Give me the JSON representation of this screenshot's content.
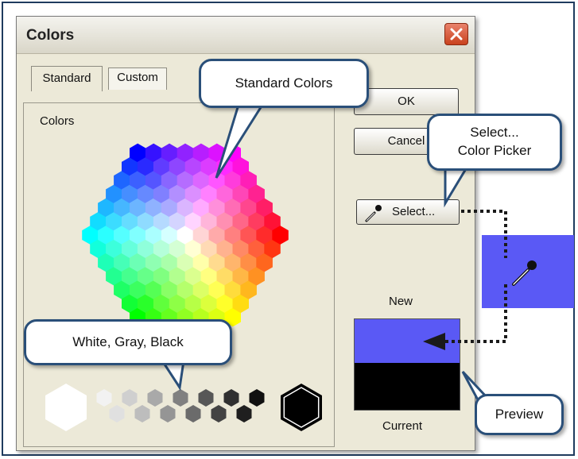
{
  "dialog": {
    "title": "Colors",
    "tabs": [
      {
        "label": "Standard"
      },
      {
        "label": "Custom"
      }
    ],
    "colors_label": "Colors",
    "ok_label": "OK",
    "cancel_label": "Cancel",
    "select_label": "Select...",
    "new_label": "New",
    "current_label": "Current"
  },
  "callouts": {
    "standard_colors": "Standard Colors",
    "select_line1": "Select...",
    "select_line2": "Color Picker",
    "gray_scale": "White, Gray, Black",
    "preview": "Preview"
  },
  "preview_colors": {
    "new": "#5a59f5",
    "current": "#000000"
  },
  "picker_swatch_color": "#5a59f5",
  "accent_color": "#2a4f79"
}
